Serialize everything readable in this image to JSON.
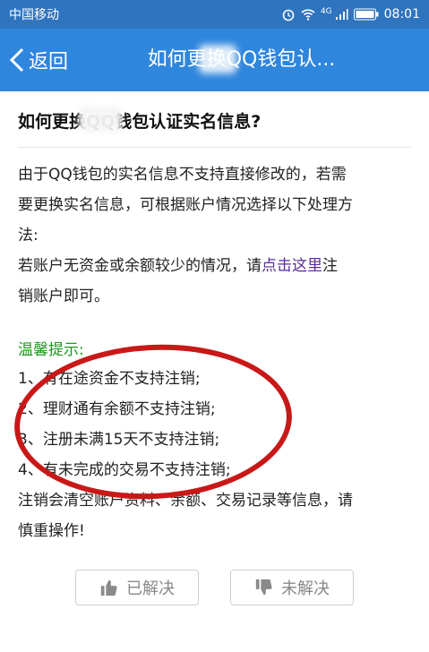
{
  "status_bar": {
    "carrier": "中国移动",
    "network": "4G",
    "time": "08:01"
  },
  "nav": {
    "back_label": "返回",
    "title": "如何更换QQ钱包认..."
  },
  "article": {
    "heading": "如何更换QQ钱包认证实名信息?",
    "paragraph_lines": [
      "由于QQ钱包的实名信息不支持直接修改的，若需",
      "要更换实名信息，可根据账户情况选择以下处理方",
      "法:"
    ],
    "cancel_prefix": "若账户无资金或余额较少的情况，请",
    "cancel_link": "点击这里",
    "cancel_suffix": "注",
    "cancel_line2": "销账户即可。",
    "tip_title": "温馨提示:",
    "tips": [
      "1、有在途资金不支持注销;",
      "2、理财通有余额不支持注销;",
      "3、注册未满15天不支持注销;",
      "4、有未完成的交易不支持注销;"
    ],
    "warning_lines": [
      "注销会清空账户资料、余额、交易记录等信息，请",
      "慎重操作!"
    ]
  },
  "feedback": {
    "solved_label": "已解决",
    "unsolved_label": "未解决"
  },
  "colors": {
    "status_bar": "#2f74bf",
    "title_bar": "#2f86dd",
    "link": "#5a2d9a",
    "tip": "#1a9a1a",
    "annotation": "#c81818"
  }
}
